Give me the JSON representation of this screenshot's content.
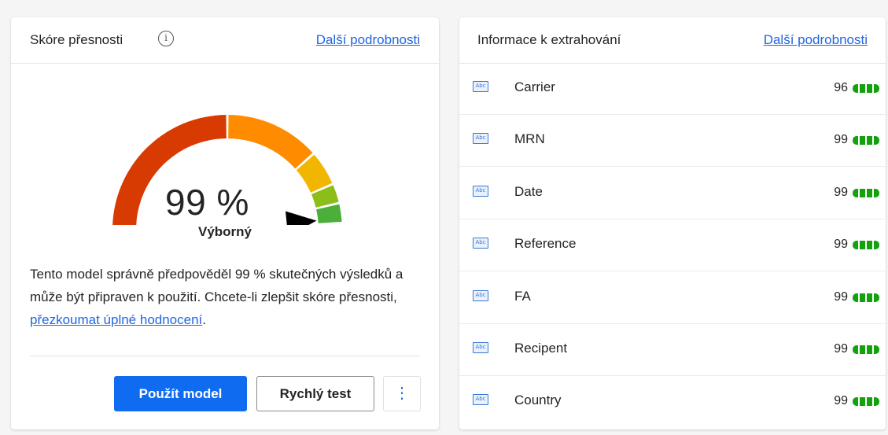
{
  "accuracy": {
    "title": "Skóre přesnosti",
    "more_link": "Další podrobnosti",
    "score_text": "99 %",
    "score_value": 99,
    "rating": "Výborný",
    "description_pre": "Tento model správně předpověděl 99 % skutečných výsledků a může být připraven k použití. Chcete-li zlepšit skóre přesnosti, ",
    "description_link": "přezkoumat úplné hodnocení",
    "description_post": ".",
    "primary_button": "Použít model",
    "secondary_button": "Rychlý test",
    "more_button": "⋮",
    "gauge_colors": [
      "#d83b01",
      "#ff8c00",
      "#f2b600",
      "#8cbd18",
      "#4caf3a"
    ]
  },
  "extraction": {
    "title": "Informace k extrahování",
    "more_link": "Další podrobnosti",
    "field_icon": "Abc",
    "confidence_color": "#13a10e",
    "fields": [
      {
        "name": "Carrier",
        "score": "96"
      },
      {
        "name": "MRN",
        "score": "99"
      },
      {
        "name": "Date",
        "score": "99"
      },
      {
        "name": "Reference",
        "score": "99"
      },
      {
        "name": "FA",
        "score": "99"
      },
      {
        "name": "Recipent",
        "score": "99"
      },
      {
        "name": "Country",
        "score": "99"
      }
    ]
  }
}
